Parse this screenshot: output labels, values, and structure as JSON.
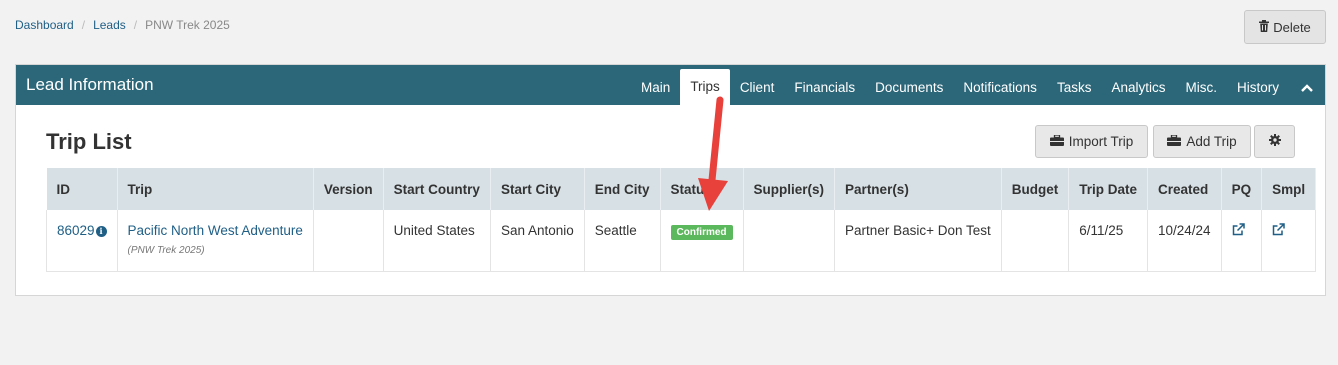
{
  "breadcrumb": {
    "items": [
      "Dashboard",
      "Leads"
    ],
    "separator": "/",
    "current": "PNW Trek 2025"
  },
  "actions": {
    "delete_label": "Delete",
    "delete_icon": "trash-icon"
  },
  "panel": {
    "title": "Lead Information",
    "tabs": [
      "Main",
      "Trips",
      "Client",
      "Financials",
      "Documents",
      "Notifications",
      "Tasks",
      "Analytics",
      "Misc.",
      "History"
    ],
    "active_tab": "Trips",
    "header_color": "#2c6779"
  },
  "trip_list": {
    "title": "Trip List",
    "import_label": "Import Trip",
    "add_label": "Add Trip",
    "settings_icon": "gear-icon",
    "columns": [
      "ID",
      "Trip",
      "Version",
      "Start Country",
      "Start City",
      "End City",
      "Status",
      "Supplier(s)",
      "Partner(s)",
      "Budget",
      "Trip Date",
      "Created",
      "PQ",
      "Smpl"
    ],
    "rows": [
      {
        "id": "86029",
        "trip_name": "Pacific North West Adventure",
        "trip_sub": "(PNW Trek 2025)",
        "version": "",
        "start_country": "United States",
        "start_city": "San Antonio",
        "end_city": "Seattle",
        "status": "Confirmed",
        "status_color": "#5cb85c",
        "suppliers": "",
        "partners": "Partner Basic+ Don Test",
        "budget": "",
        "trip_date": "6/11/25",
        "created": "10/24/24"
      }
    ]
  },
  "annotation": {
    "arrow_color": "#e8403a"
  }
}
